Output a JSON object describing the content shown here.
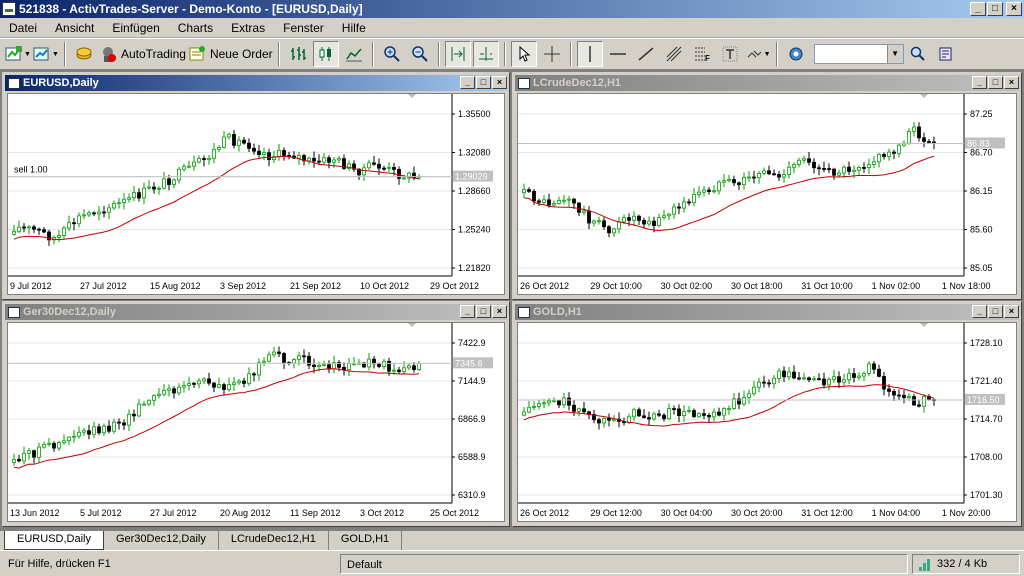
{
  "window": {
    "title": "521838 - ActivTrades-Server - Demo-Konto - [EURUSD,Daily]",
    "controls": [
      "_",
      "□",
      "×"
    ]
  },
  "menu": [
    "Datei",
    "Ansicht",
    "Einfügen",
    "Charts",
    "Extras",
    "Fenster",
    "Hilfe"
  ],
  "toolbar": {
    "autotrading_label": "AutoTrading",
    "new_order_label": "Neue Order",
    "combo_value": ""
  },
  "charts": [
    {
      "name": "EURUSD,Daily",
      "active": true,
      "yticks": [
        "1.35500",
        "1.32080",
        "1.28660",
        "1.25240",
        "1.21820"
      ],
      "price_label": "1.29029",
      "order_label": "sell 1.00",
      "xticks": [
        "9 Jul 2012",
        "27 Jul 2012",
        "15 Aug 2012",
        "3 Sep 2012",
        "21 Sep 2012",
        "10 Oct 2012",
        "29 Oct 2012"
      ],
      "colors": {
        "up": "#00a000",
        "down": "#000000",
        "ma": "#c00000"
      }
    },
    {
      "name": "LCrudeDec12,H1",
      "active": false,
      "yticks": [
        "87.25",
        "86.70",
        "86.15",
        "85.60",
        "85.05"
      ],
      "price_label": "86.83",
      "xticks": [
        "26 Oct 2012",
        "29 Oct 10:00",
        "30 Oct 02:00",
        "30 Oct 18:00",
        "31 Oct 10:00",
        "1 Nov 02:00",
        "1 Nov 18:00"
      ],
      "colors": {
        "up": "#00a000",
        "down": "#000000",
        "ma": "#c00000"
      }
    },
    {
      "name": "Ger30Dec12,Daily",
      "active": false,
      "yticks": [
        "7422.9",
        "7144.9",
        "6866.9",
        "6588.9",
        "6310.9"
      ],
      "price_label": "7345.6",
      "xticks": [
        "13 Jun 2012",
        "5 Jul 2012",
        "27 Jul 2012",
        "20 Aug 2012",
        "11 Sep 2012",
        "3 Oct 2012",
        "25 Oct 2012"
      ],
      "colors": {
        "up": "#00a000",
        "down": "#000000",
        "ma": "#c00000"
      }
    },
    {
      "name": "GOLD,H1",
      "active": false,
      "yticks": [
        "1728.10",
        "1721.40",
        "1714.70",
        "1708.00",
        "1701.30"
      ],
      "price_label": "1716.50",
      "xticks": [
        "26 Oct 2012",
        "29 Oct 12:00",
        "30 Oct 04:00",
        "30 Oct 20:00",
        "31 Oct 12:00",
        "1 Nov 04:00",
        "1 Nov 20:00"
      ],
      "colors": {
        "up": "#00a000",
        "down": "#000000",
        "ma": "#c00000"
      }
    }
  ],
  "tabs": [
    "EURUSD,Daily",
    "Ger30Dec12,Daily",
    "LCrudeDec12,H1",
    "GOLD,H1"
  ],
  "status": {
    "help": "Für Hilfe, drücken F1",
    "profile": "Default",
    "traffic": "332 / 4 Kb"
  }
}
